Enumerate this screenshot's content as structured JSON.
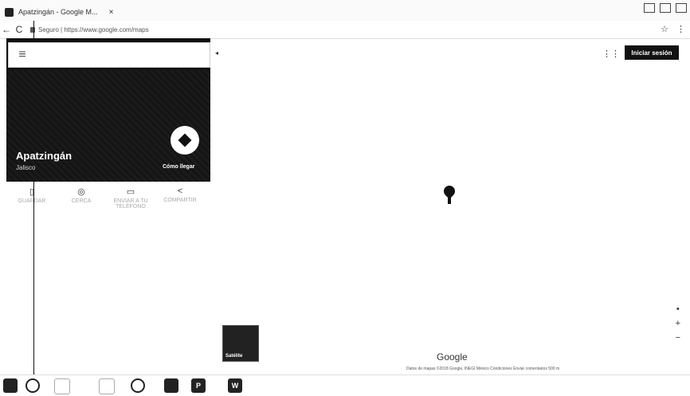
{
  "browser": {
    "tab_title": "Apatzingán - Google M...",
    "tab_close": "×",
    "url": "https://www.google.com/maps",
    "url_prefix": "Seguro"
  },
  "maps": {
    "place_name": "Apatzingán",
    "place_region": "Jalisco",
    "directions_label": "Cómo llegar",
    "signin_label": "Iniciar sesión",
    "satellite_label": "Satélite",
    "logo_text": "Google",
    "footer_text": "Datos de mapas ©2018 Google, INEGI   México   Condiciones   Enviar comentarios   500 m",
    "actions": [
      {
        "label": "GUARDAR"
      },
      {
        "label": "CERCA"
      },
      {
        "label": "ENVIAR A TU TELÉFONO"
      },
      {
        "label": "COMPARTIR"
      }
    ]
  },
  "icons": {
    "hamburger": "≡",
    "back": "←",
    "reload": "C",
    "apps": "⋮⋮",
    "star": "☆",
    "menu_dots": "⋮",
    "zoom_in": "+",
    "zoom_out": "−",
    "compass": "•"
  }
}
